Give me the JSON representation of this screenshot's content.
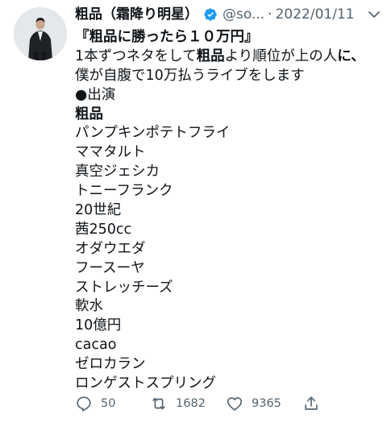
{
  "author": {
    "display_name": "粗品（霜降り明星）",
    "handle": "@so...",
    "separator": "·",
    "date": "2022/01/11"
  },
  "tweet": {
    "l1": "『粗品に勝ったら１０万円』",
    "l2a": "1本ずつネタをして",
    "l2b": "粗品",
    "l2c": "より順位が上の人",
    "l2d": "に、",
    "l3": "僕が自腹で10万払うライブをします",
    "l4": "●出演",
    "l5": "粗品",
    "performers": [
      "パンプキンポテトフライ",
      "ママタルト",
      "真空ジェシカ",
      "トニーフランク",
      "20世紀",
      "茜250cc",
      "オダウエダ",
      "フースーヤ",
      "ストレッチーズ",
      "軟水",
      "10億円",
      "cacao",
      "ゼロカラン",
      "ロンゲストスプリング"
    ]
  },
  "stats": {
    "replies": "50",
    "retweets": "1682",
    "likes": "9365"
  },
  "icons": {
    "verified": "verified-badge-icon",
    "more": "chevron-down-icon",
    "reply": "reply-icon",
    "retweet": "retweet-icon",
    "like": "heart-icon",
    "share": "share-icon"
  },
  "colors": {
    "text": "#0f1419",
    "secondary": "#536471",
    "verified": "#1d9bf0"
  }
}
